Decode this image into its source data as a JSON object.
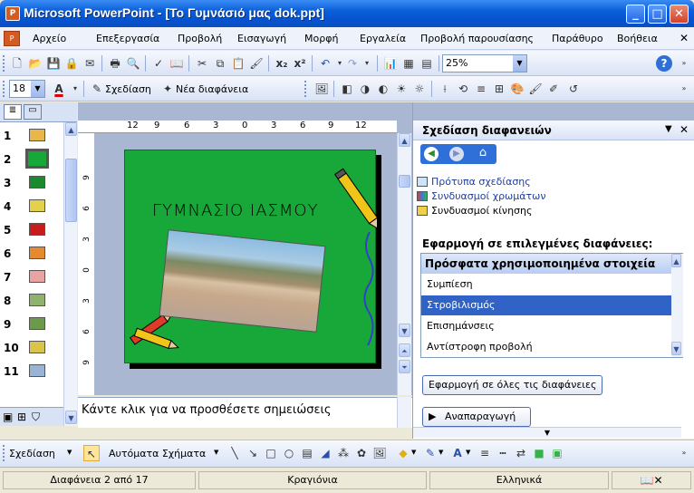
{
  "window": {
    "title": "Microsoft PowerPoint - [Το Γυμνάσιό μας dok.ppt]",
    "minimize": "_",
    "maximize": "□",
    "close": "✕"
  },
  "menu": {
    "items": [
      "Αρχείο",
      "Επεξεργασία",
      "Προβολή",
      "Εισαγωγή",
      "Μορφή",
      "Εργαλεία",
      "Προβολή παρουσίασης",
      "Παράθυρο",
      "Βοήθεια"
    ],
    "close_doc": "✕"
  },
  "toolbar1": {
    "zoom": "25%"
  },
  "toolbar2": {
    "font_size": "18",
    "design_label": "Σχεδίαση",
    "new_slide_label": "Νέα διαφάνεια"
  },
  "slides_panel": {
    "numbers": [
      "1",
      "2",
      "3",
      "4",
      "5",
      "6",
      "7",
      "8",
      "9",
      "10",
      "11"
    ],
    "selected": 2
  },
  "ruler": {
    "h_ticks": [
      "12",
      "9",
      "6",
      "3",
      "0",
      "3",
      "6",
      "9",
      "12"
    ],
    "v_ticks": [
      "9",
      "6",
      "3",
      "0",
      "3",
      "6",
      "9"
    ]
  },
  "slide": {
    "title": "ΓΥΜΝΑΣΙΟ  ΙΑΣΜΟΥ"
  },
  "notes": {
    "placeholder": "Κάντε κλικ για να προσθέσετε σημειώσεις"
  },
  "taskpane": {
    "title": "Σχεδίαση διαφανειών",
    "links": [
      "Πρότυπα σχεδίασης",
      "Συνδυασμοί χρωμάτων",
      "Συνδυασμοί κίνησης"
    ],
    "apply_heading": "Εφαρμογή σε επιλεγμένες διαφάνειες:",
    "list_header": "Πρόσφατα χρησιμοποιημένα στοιχεία",
    "list_items": [
      "Συμπίεση",
      "Στροβιλισμός",
      "Επισημάνσεις",
      "Αντίστροφη προβολή"
    ],
    "selected_index": 1,
    "apply_all_button": "Εφαρμογή σε όλες τις διαφάνειες",
    "play_button": "Αναπαραγωγή"
  },
  "drawing_toolbar": {
    "draw_label": "Σχεδίαση",
    "autoshapes_label": "Αυτόματα Σχήματα"
  },
  "statusbar": {
    "slide_info": "Διαφάνεια 2 από 17",
    "design_name": "Κραγιόνια",
    "language": "Ελληνικά"
  },
  "colors": {
    "slide_bg": "#18a83a",
    "titlebar": "#0a5fd9",
    "selection": "#3162c5"
  }
}
